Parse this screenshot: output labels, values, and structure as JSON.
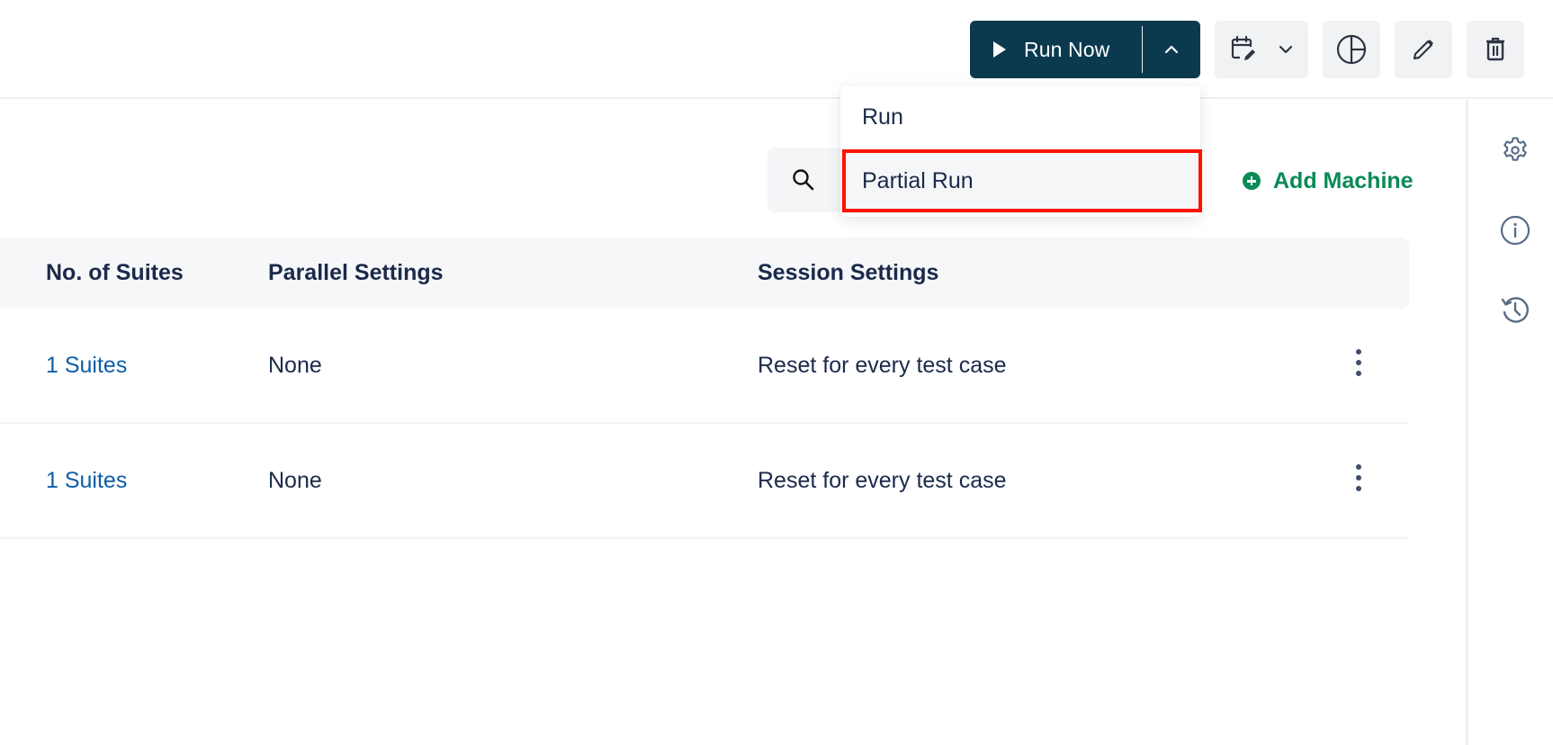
{
  "toolbar": {
    "run_now_label": "Run Now",
    "run_now_icon": "play-icon",
    "run_menu_toggle_icon": "chevron-up-icon",
    "schedule_icon": "calendar-edit-icon",
    "schedule_dropdown_icon": "chevron-down-icon",
    "report_icon": "pie-chart-icon",
    "edit_icon": "pencil-icon",
    "delete_icon": "trash-icon"
  },
  "run_menu": {
    "items": [
      {
        "label": "Run"
      },
      {
        "label": "Partial Run",
        "highlighted": true
      }
    ]
  },
  "search": {
    "icon": "search-icon",
    "placeholder": ""
  },
  "add_machine": {
    "label": "Add Machine",
    "icon": "plus-circle-icon"
  },
  "table": {
    "columns": [
      "No. of Suites",
      "Parallel Settings",
      "Session Settings"
    ],
    "rows": [
      {
        "suites": "1 Suites",
        "parallel": "None",
        "session": "Reset for every test case"
      },
      {
        "suites": "1 Suites",
        "parallel": "None",
        "session": "Reset for every test case"
      }
    ]
  },
  "right_rail": {
    "icons": [
      "gear-icon",
      "info-icon",
      "history-icon"
    ]
  },
  "colors": {
    "primary": "#0b3a4f",
    "accent_green": "#0a8a56",
    "link_blue": "#0b5ea8",
    "highlight_red": "#ff1100"
  }
}
